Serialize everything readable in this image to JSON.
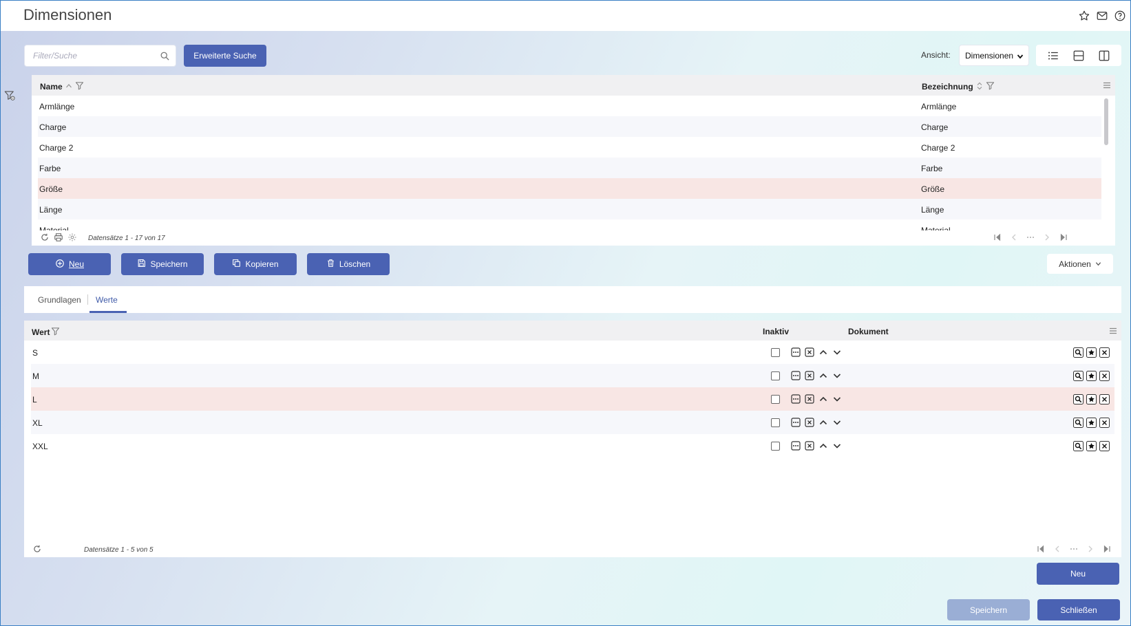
{
  "header": {
    "title": "Dimensionen",
    "icons": [
      "star-icon",
      "mail-icon",
      "help-icon"
    ]
  },
  "toolbar": {
    "search_placeholder": "Filter/Suche",
    "advanced_search_label": "Erweiterte Suche",
    "view_label": "Ansicht:",
    "view_value": "Dimensionen",
    "view_modes": [
      "list-view-icon",
      "split-horizontal-icon",
      "split-vertical-icon"
    ]
  },
  "dimensions_grid": {
    "columns": {
      "name": "Name",
      "bezeichnung": "Bezeichnung"
    },
    "rows": [
      {
        "name": "Armlänge",
        "bezeichnung": "Armlänge"
      },
      {
        "name": "Charge",
        "bezeichnung": "Charge"
      },
      {
        "name": "Charge 2",
        "bezeichnung": "Charge 2"
      },
      {
        "name": "Farbe",
        "bezeichnung": "Farbe"
      },
      {
        "name": "Größe",
        "bezeichnung": "Größe",
        "selected": true
      },
      {
        "name": "Länge",
        "bezeichnung": "Länge"
      },
      {
        "name": "Material",
        "bezeichnung": "Material"
      }
    ],
    "records_text": "Datensätze 1 - 17 von 17"
  },
  "actions": {
    "new": "Neu",
    "save": "Speichern",
    "copy": "Kopieren",
    "delete": "Löschen",
    "more": "Aktionen"
  },
  "tabs": {
    "basics": "Grundlagen",
    "values": "Werte",
    "active": "values"
  },
  "values_grid": {
    "columns": {
      "wert": "Wert",
      "inaktiv": "Inaktiv",
      "dokument": "Dokument"
    },
    "rows": [
      {
        "wert": "S",
        "inaktiv": false
      },
      {
        "wert": "M",
        "inaktiv": false
      },
      {
        "wert": "L",
        "inaktiv": false,
        "selected": true
      },
      {
        "wert": "XL",
        "inaktiv": false
      },
      {
        "wert": "XXL",
        "inaktiv": false
      }
    ],
    "records_text": "Datensätze 1 - 5 von 5"
  },
  "footer": {
    "new": "Neu",
    "save": "Speichern",
    "close": "Schließen"
  },
  "colors": {
    "primary": "#4a62b3",
    "selected_row": "#f8e6e4",
    "disabled": "#9aaed5"
  }
}
